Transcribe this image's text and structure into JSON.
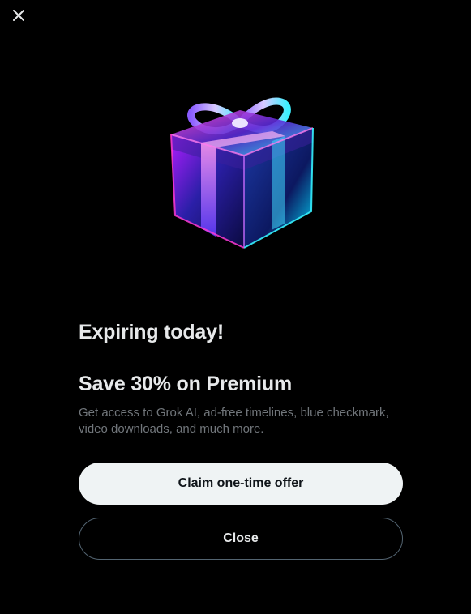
{
  "dialog": {
    "close_icon": "close-icon",
    "illustration": "gift-box-icon",
    "headline": "Expiring today!",
    "subheadline": "Save 30% on Premium",
    "description": "Get access to Grok AI, ad-free timelines, blue checkmark, video downloads, and much more.",
    "primary_button": "Claim one-time offer",
    "secondary_button": "Close"
  },
  "colors": {
    "background": "#000000",
    "text_primary": "#e7e9ea",
    "text_secondary": "#71767b",
    "primary_button_bg": "#eff3f4",
    "primary_button_text": "#0f1419",
    "secondary_button_border": "#536471"
  }
}
